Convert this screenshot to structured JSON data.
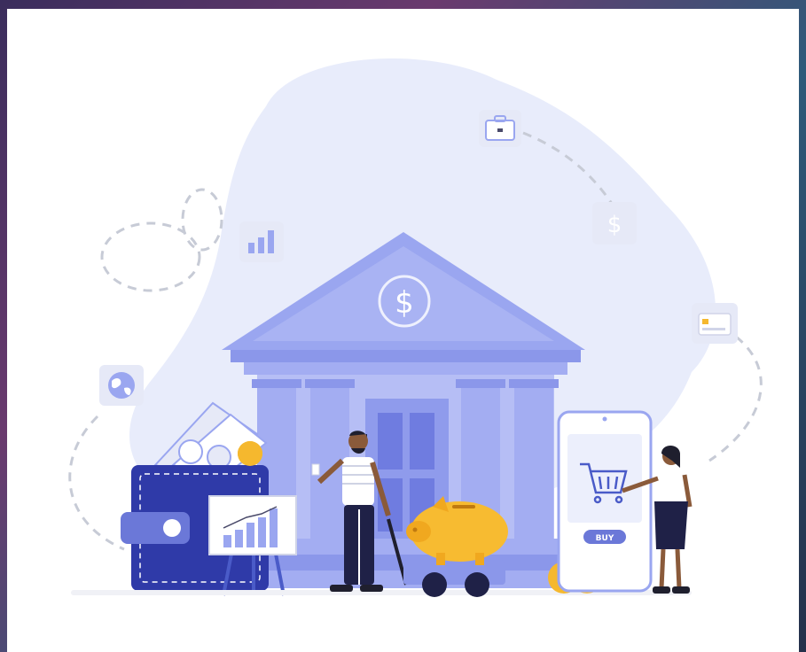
{
  "illustration": {
    "buy_button_label": "BUY",
    "currency_symbol": "$",
    "colors": {
      "background_blob": "#e8ecfb",
      "bank": "#9aa6f0",
      "bank_dark": "#7f8ce6",
      "wallet": "#2f3aa8",
      "coin": "#f5b82e",
      "piggy": "#f7bb31",
      "dashed_line": "#c7cbd6"
    },
    "icons": [
      "briefcase-icon",
      "dollar-icon",
      "bar-chart-icon",
      "globe-icon",
      "credit-card-icon",
      "shopping-cart-icon"
    ]
  }
}
